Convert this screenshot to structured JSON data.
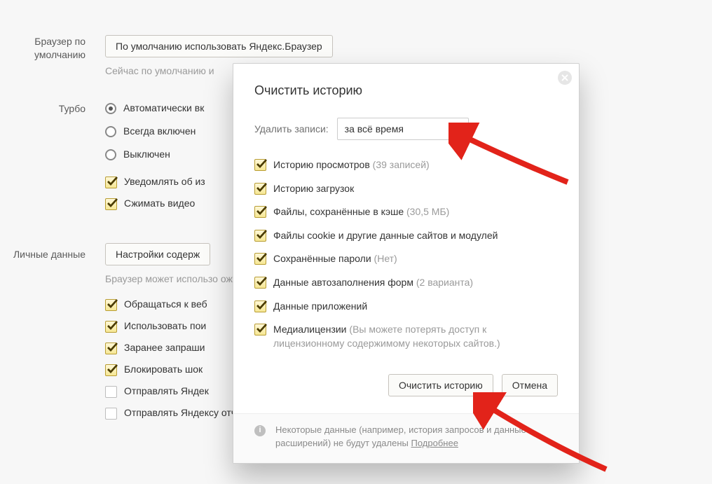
{
  "sections": {
    "default_browser": {
      "label": "Браузер по умолчанию",
      "button": "По умолчанию использовать Яндекс.Браузер",
      "note": "Сейчас по умолчанию и"
    },
    "turbo": {
      "label": "Турбо",
      "options": {
        "auto": "Автоматически вк",
        "always": "Всегда включен",
        "off": "Выключен"
      },
      "notify": "Уведомлять об из",
      "compress": "Сжимать видео"
    },
    "personal": {
      "label": "Личные данные",
      "button": "Настройки содерж",
      "note": "Браузер может использо\tожности вам не нужны, их можно отк",
      "c1": "Обращаться к веб",
      "c2": "Использовать пои",
      "c3": "Заранее запраши",
      "c4": "Блокировать шок",
      "c5": "Отправлять Яндек",
      "c6": "Отправлять Яндексу отчеты о сбоях"
    }
  },
  "modal": {
    "title": "Очистить историю",
    "period_label": "Удалить записи:",
    "period_value": "за всё время",
    "items": [
      {
        "text": "Историю просмотров",
        "suffix": "(39 записей)"
      },
      {
        "text": "Историю загрузок",
        "suffix": ""
      },
      {
        "text": "Файлы, сохранённые в кэше",
        "suffix": "(30,5 МБ)"
      },
      {
        "text": "Файлы cookie и другие данные сайтов и модулей",
        "suffix": ""
      },
      {
        "text": "Сохранённые пароли",
        "suffix": "(Нет)"
      },
      {
        "text": "Данные автозаполнения форм",
        "suffix": "(2 варианта)"
      },
      {
        "text": "Данные приложений",
        "suffix": ""
      },
      {
        "text": "Медиалицензии",
        "suffix": "(Вы можете потерять доступ к лицензионному содержимому некоторых сайтов.)"
      }
    ],
    "clear_button": "Очистить историю",
    "cancel_button": "Отмена",
    "footer_text": "Некоторые данные (например, история запросов и данные расширений) не будут удалены",
    "footer_more": "Подробнее"
  }
}
